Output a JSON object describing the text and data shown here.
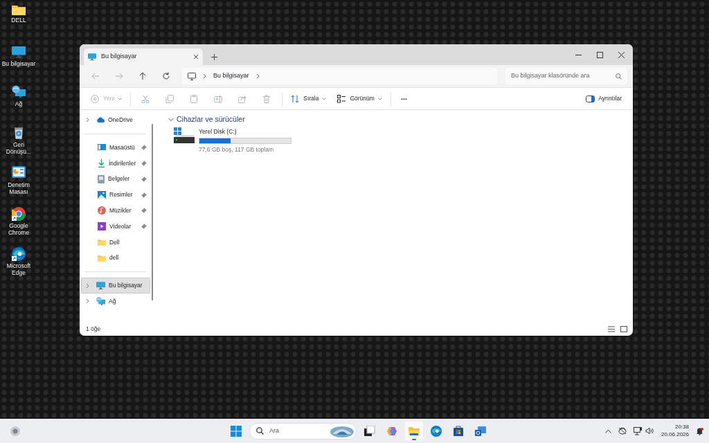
{
  "desktop_icons": [
    {
      "label": "DELL",
      "kind": "folder"
    },
    {
      "label": "Bu bilgisayar",
      "kind": "computer"
    },
    {
      "label": "Ağ",
      "kind": "network"
    },
    {
      "label": "Geri Dönüşü...",
      "kind": "recycle"
    },
    {
      "label": "Denetim Masası",
      "kind": "control"
    },
    {
      "label": "Google Chrome",
      "kind": "chrome"
    },
    {
      "label": "Microsoft Edge",
      "kind": "edge"
    }
  ],
  "window": {
    "tabs": [
      {
        "title": "Bu bilgisayar",
        "selected": true
      }
    ],
    "nav": [
      {
        "kind": "back",
        "disabled": true
      },
      {
        "kind": "forward",
        "disabled": true
      },
      {
        "kind": "up",
        "disabled": false
      },
      {
        "kind": "refresh",
        "disabled": false
      }
    ],
    "address": {
      "segments": [
        "Bu bilgisayar"
      ]
    },
    "search": {
      "placeholder": "Bu bilgisayar klasöründe ara"
    },
    "toolbar": [
      {
        "kind": "new",
        "label": "Yeni",
        "disabled": true
      },
      {
        "kind": "cut",
        "disabled": true
      },
      {
        "kind": "copy",
        "disabled": true
      },
      {
        "kind": "paste",
        "disabled": true
      },
      {
        "kind": "rename",
        "disabled": true
      },
      {
        "kind": "share",
        "disabled": true
      },
      {
        "kind": "delete",
        "disabled": true
      },
      {
        "kind": "sort",
        "label": "Sırala",
        "disabled": false
      },
      {
        "kind": "view",
        "label": "Görünüm",
        "disabled": false
      },
      {
        "kind": "more",
        "label": "...",
        "disabled": false
      },
      {
        "kind": "details",
        "label": "Ayrıntılar",
        "disabled": false
      }
    ],
    "sidebar": {
      "sections": [
        {
          "items": [
            {
              "label": "OneDrive",
              "kind": "cloud",
              "expandable": true,
              "pinned": false,
              "selected": false
            }
          ]
        },
        {
          "items": [
            {
              "label": "Masaüstü",
              "kind": "desktop",
              "expandable": false,
              "pinned": true,
              "selected": false
            },
            {
              "label": "İndirilenler",
              "kind": "download",
              "expandable": false,
              "pinned": true,
              "selected": false
            },
            {
              "label": "Belgeler",
              "kind": "document",
              "expandable": false,
              "pinned": true,
              "selected": false
            },
            {
              "label": "Resimler",
              "kind": "pictures",
              "expandable": false,
              "pinned": true,
              "selected": false
            },
            {
              "label": "Müzikler",
              "kind": "music",
              "expandable": false,
              "pinned": true,
              "selected": false
            },
            {
              "label": "Videolar",
              "kind": "video",
              "expandable": false,
              "pinned": true,
              "selected": false
            },
            {
              "label": "Dell",
              "kind": "folder",
              "expandable": false,
              "pinned": false,
              "selected": false
            },
            {
              "label": "dell",
              "kind": "folder",
              "expandable": false,
              "pinned": false,
              "selected": false
            }
          ]
        },
        {
          "items": [
            {
              "label": "Bu bilgisayar",
              "kind": "computer",
              "expandable": true,
              "pinned": false,
              "selected": true
            },
            {
              "label": "Ağ",
              "kind": "network",
              "expandable": true,
              "pinned": false,
              "selected": false
            }
          ]
        }
      ]
    },
    "groups": [
      {
        "title": "Cihazlar ve sürücüler",
        "expanded": true,
        "drives": [
          {
            "name": "Yerel Disk (C:)",
            "level": 0.34,
            "info": "77,6 GB boş, 117 GB toplam"
          }
        ]
      }
    ],
    "status_bar": {
      "text": "1 öğe"
    }
  },
  "taskbar": {
    "search": {
      "placeholder": "Ara"
    },
    "apps": [
      {
        "kind": "taskview",
        "selected": false
      },
      {
        "kind": "copilot",
        "selected": false
      },
      {
        "kind": "explorer",
        "selected": true
      },
      {
        "kind": "edge",
        "selected": false
      },
      {
        "kind": "store",
        "selected": false
      },
      {
        "kind": "outlook",
        "selected": false
      }
    ],
    "clock": {
      "time": "20:38",
      "date": "20.06.2026"
    }
  }
}
